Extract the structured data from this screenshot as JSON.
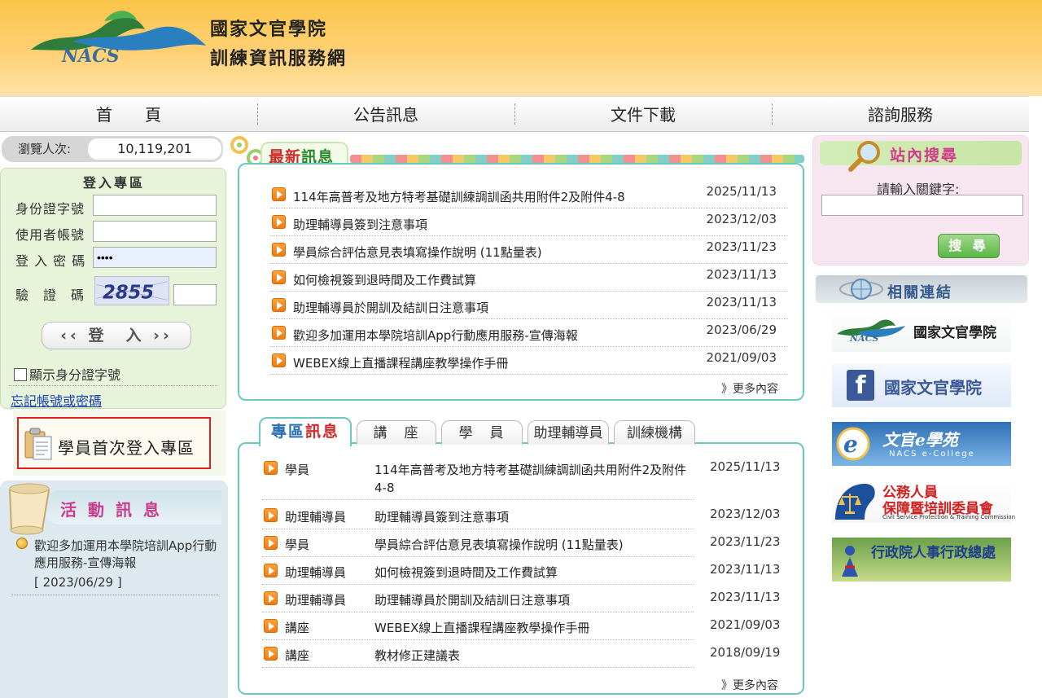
{
  "header": {
    "logo_text": "NACS",
    "title_line1": "國家文官學院",
    "title_line2": "訓練資訊服務網"
  },
  "nav": [
    "首　　頁",
    "公告訊息",
    "文件下載",
    "諮詢服務"
  ],
  "visitor": {
    "label": "瀏覽人次:",
    "count": "10,119,201"
  },
  "login": {
    "title": "登入專區",
    "id_label": "身份證字號",
    "account_label": "使用者帳號",
    "password_label": "登 入 密 碼",
    "password_value": "••••",
    "captcha_label": "驗　證　碼",
    "captcha_code": "2855",
    "login_button": "‹‹ 登　入 ››",
    "show_id_label": "顯示身分證字號",
    "forgot_link": "忘記帳號或密碼"
  },
  "first_login": {
    "label": "學員首次登入專區"
  },
  "activity": {
    "title": "活動訊息",
    "item_text": "歡迎多加運用本學院培訓App行動應用服務-宣傳海報",
    "item_date": "[ 2023/06/29 ]"
  },
  "latest": {
    "tab_label_a": "最新",
    "tab_label_b": "訊息",
    "items": [
      {
        "title": "114年高普考及地方特考基礎訓練調訓函共用附件2及附件4-8",
        "date": "2025/11/13"
      },
      {
        "title": "助理輔導員簽到注意事項",
        "date": "2023/12/03"
      },
      {
        "title": "學員綜合評估意見表填寫操作說明 (11點量表)",
        "date": "2023/11/23"
      },
      {
        "title": "如何檢視簽到退時間及工作費試算",
        "date": "2023/11/13"
      },
      {
        "title": "助理輔導員於開訓及結訓日注意事項",
        "date": "2023/11/13"
      },
      {
        "title": "歡迎多加運用本學院培訓App行動應用服務-宣傳海報",
        "date": "2023/06/29"
      },
      {
        "title": "WEBEX線上直播課程講座教學操作手冊",
        "date": "2021/09/03"
      }
    ],
    "more": "》更多內容"
  },
  "special": {
    "tabs": [
      {
        "label_a": "專區",
        "label_b": "訊息"
      },
      {
        "label": "講　座"
      },
      {
        "label": "學　員"
      },
      {
        "label": "助理輔導員"
      },
      {
        "label": "訓練機構"
      }
    ],
    "items": [
      {
        "cat": "學員",
        "title": "114年高普考及地方特考基礎訓練調訓函共用附件2及附件4-8",
        "date": "2025/11/13"
      },
      {
        "cat": "助理輔導員",
        "title": "助理輔導員簽到注意事項",
        "date": "2023/12/03"
      },
      {
        "cat": "學員",
        "title": "學員綜合評估意見表填寫操作說明 (11點量表)",
        "date": "2023/11/23"
      },
      {
        "cat": "助理輔導員",
        "title": "如何檢視簽到退時間及工作費試算",
        "date": "2023/11/13"
      },
      {
        "cat": "助理輔導員",
        "title": "助理輔導員於開訓及結訓日注意事項",
        "date": "2023/11/13"
      },
      {
        "cat": "講座",
        "title": "WEBEX線上直播課程講座教學操作手冊",
        "date": "2021/09/03"
      },
      {
        "cat": "講座",
        "title": "教材修正建議表",
        "date": "2018/09/19"
      }
    ],
    "more": "》更多內容"
  },
  "search": {
    "title": "站內搜尋",
    "label": "請輸入關鍵字:",
    "button": "搜 尋"
  },
  "links": {
    "title": "相關連結",
    "nacs": "國家文官學院",
    "nacs_logo": "NACS",
    "fb": "國家文官學院",
    "fb_icon": "f",
    "ecollege": "文官e學苑",
    "ecollege_sub": "NACS e-College",
    "csptc": "公務人員",
    "csptc2": "保障暨培訓委員會",
    "csptc_en": "Civil Service Protection & Training Commission",
    "dgpa": "行政院人事行政總處"
  },
  "colors": {
    "accent_teal": "#6cc7c0",
    "header_yellow": "#f9c447",
    "link_blue": "#1a3fb5",
    "highlight_red": "#e02020"
  }
}
